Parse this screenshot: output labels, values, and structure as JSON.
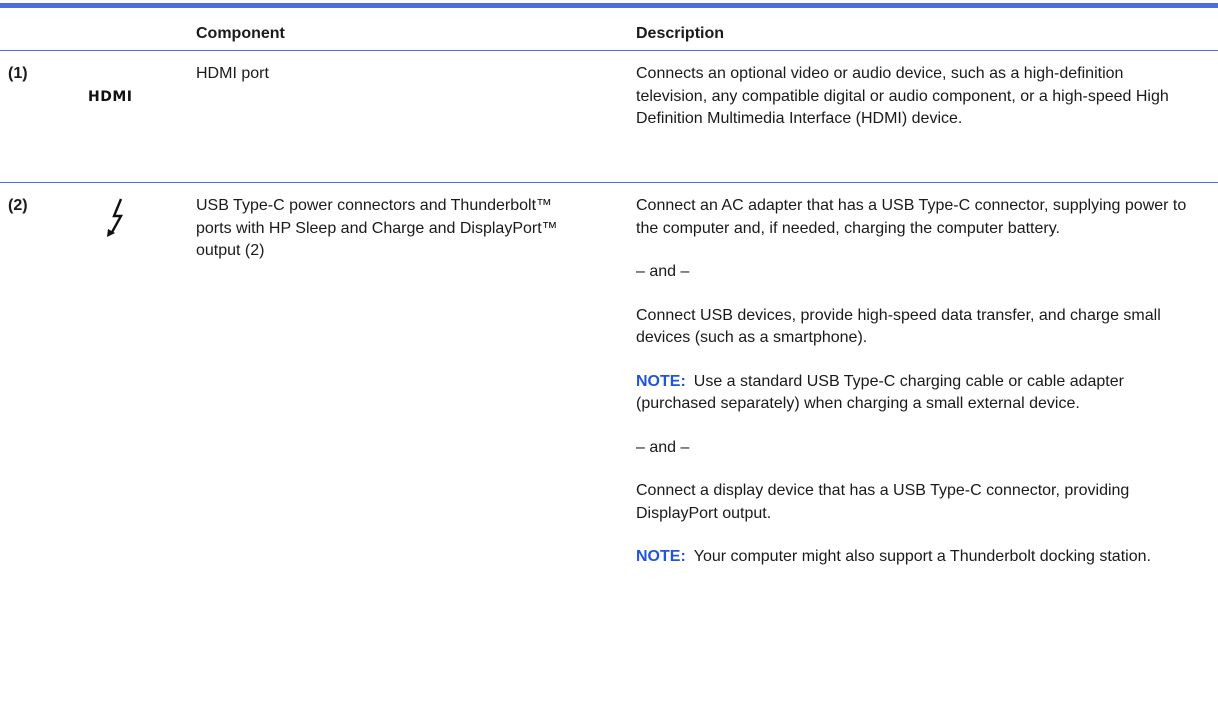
{
  "table": {
    "headers": {
      "component": "Component",
      "description": "Description"
    },
    "rows": [
      {
        "number": "(1)",
        "icon": "hdmi-icon",
        "icon_text": "HDMI",
        "component": "HDMI port",
        "description": [
          "Connects an optional video or audio device, such as a high-definition television, any compatible digital or audio component, or a high-speed High Definition Multimedia Interface (HDMI) device."
        ]
      },
      {
        "number": "(2)",
        "icon": "thunderbolt-icon",
        "component": "USB Type-C power connectors and Thunderbolt™ ports with HP Sleep and Charge and DisplayPort™ output (2)",
        "description": [
          "Connect an AC adapter that has a USB Type-C connector, supplying power to the computer and, if needed, charging the computer battery.",
          "– and –",
          "Connect USB devices, provide high-speed data transfer, and charge small devices (such as a smartphone).",
          {
            "note_label": "NOTE:",
            "note_text": "Use a standard USB Type-C charging cable or cable adapter (purchased separately) when charging a small external device."
          },
          "– and –",
          "Connect a display device that has a USB Type-C connector, providing DisplayPort output.",
          {
            "note_label": "NOTE:",
            "note_text": "Your computer might also support a Thunderbolt docking station."
          }
        ]
      }
    ]
  },
  "colors": {
    "rule": "#4a6fe0",
    "note_label": "#2255dd"
  }
}
